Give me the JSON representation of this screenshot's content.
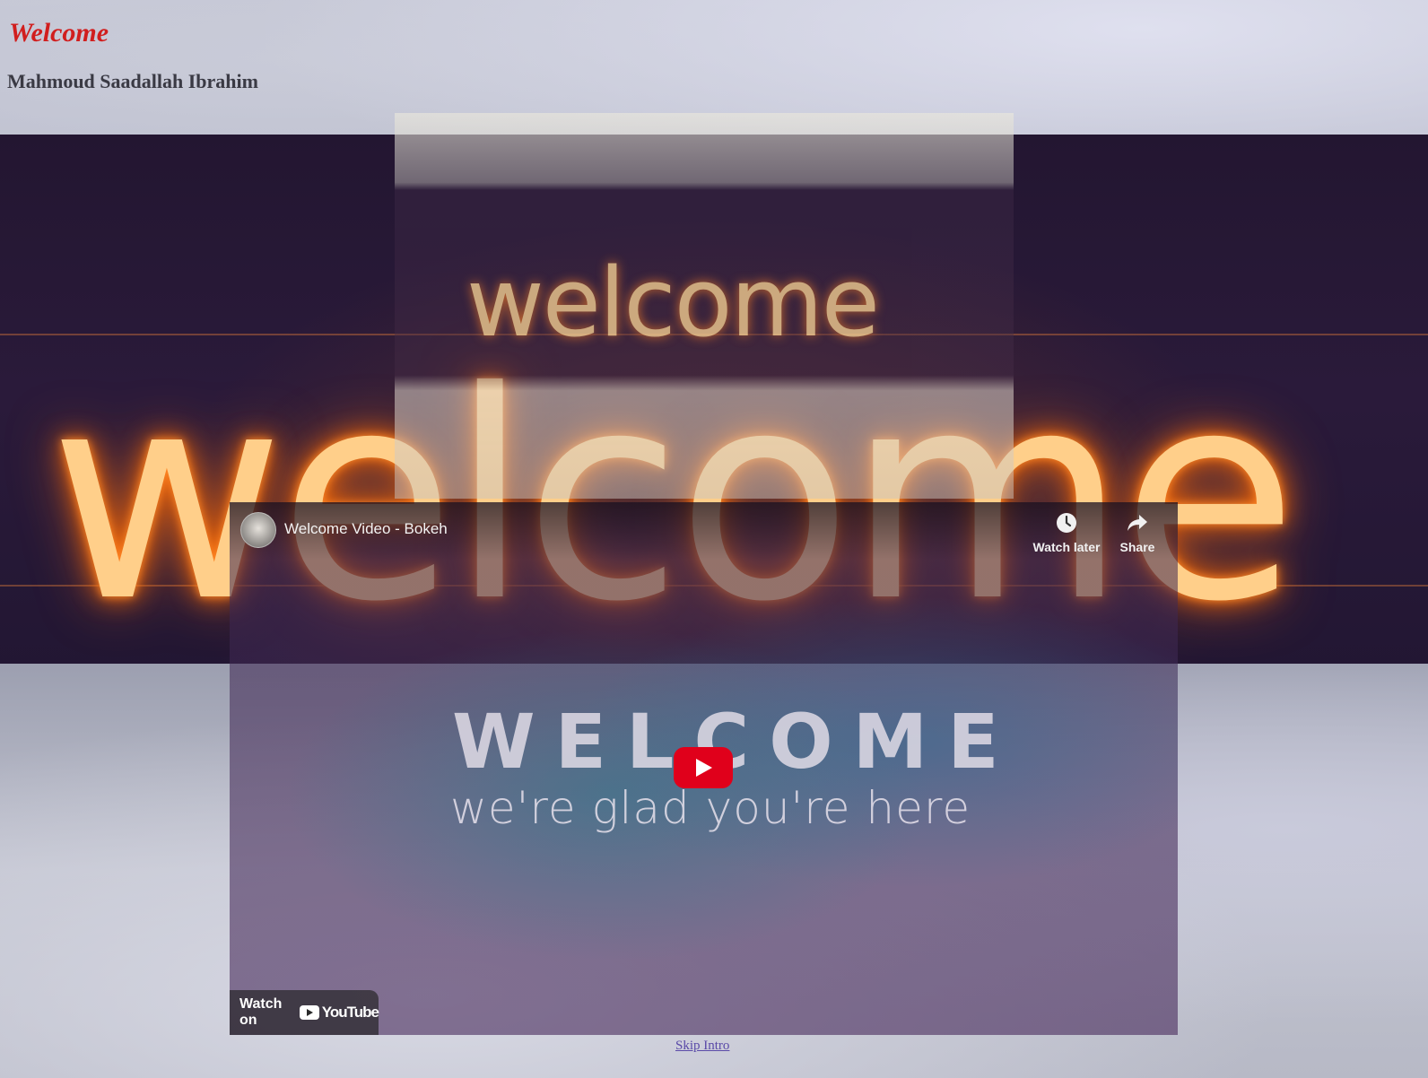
{
  "page": {
    "heading": "Welcome",
    "author": "Mahmoud Saadallah Ibrahim"
  },
  "background": {
    "word": "welcome",
    "accent_color": "#ff7a1a"
  },
  "overlay_image": {
    "word": "welcome"
  },
  "video": {
    "title": "Welcome Video - Bokeh",
    "channel_avatar_icon": "channel-avatar",
    "headline": "WELCOME",
    "tagline": "we're glad you're here",
    "watch_later_label": "Watch later",
    "share_label": "Share",
    "watch_on_label": "Watch on",
    "youtube_brand": "YouTube",
    "play_button_color": "#e0001b"
  },
  "links": {
    "skip_intro": "Skip Intro"
  }
}
